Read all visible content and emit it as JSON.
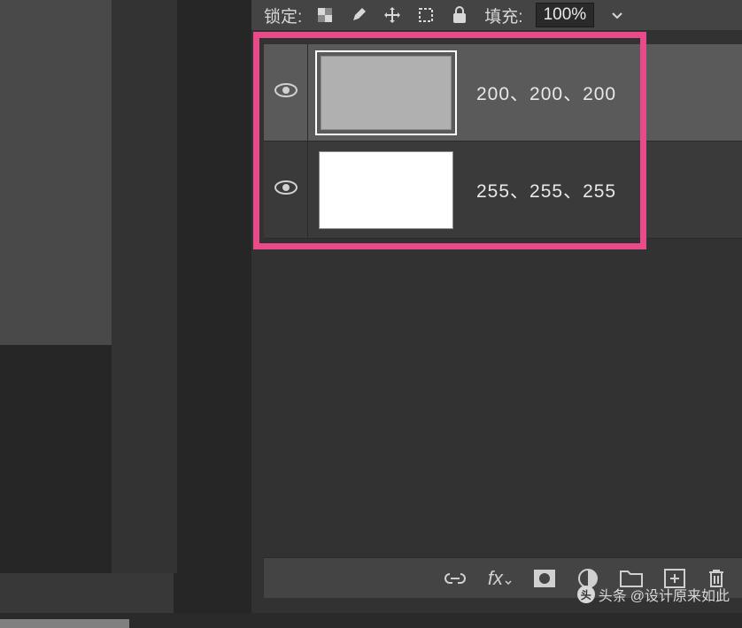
{
  "lock_bar": {
    "lock_label": "锁定:",
    "fill_label": "填充:",
    "fill_value": "100%"
  },
  "layers": [
    {
      "name": "200、200、200",
      "selected": true,
      "thumb_color": "#b0b0b0"
    },
    {
      "name": "255、255、255",
      "selected": false,
      "thumb_color": "#ffffff"
    }
  ],
  "watermark": {
    "prefix": "头条",
    "handle": "@设计原来如此"
  }
}
